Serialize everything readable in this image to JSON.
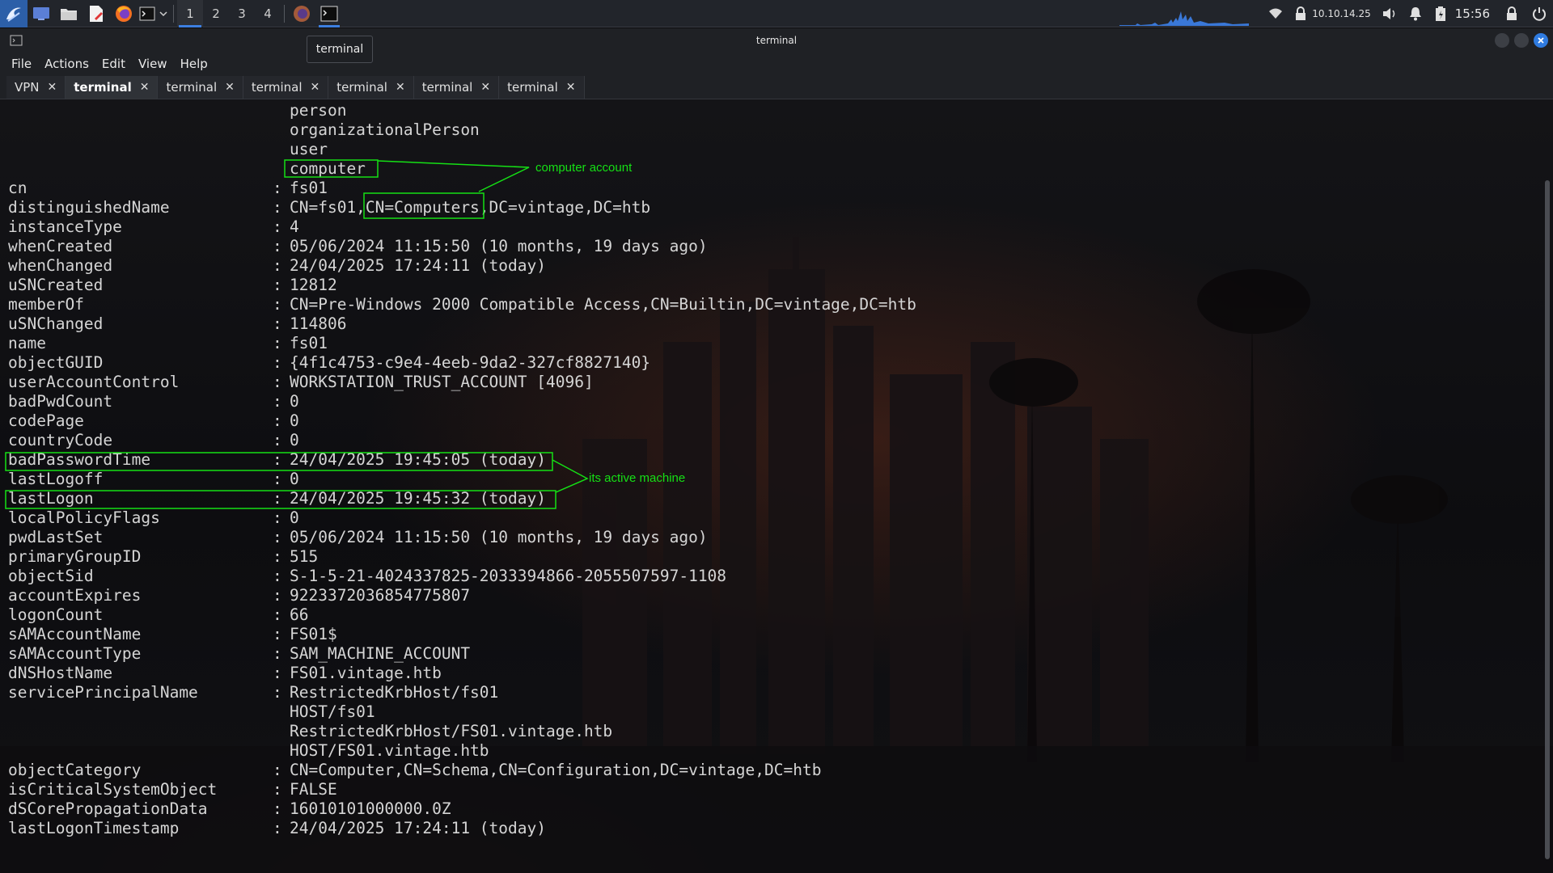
{
  "taskbar": {
    "workspaces": [
      "1",
      "2",
      "3",
      "4"
    ],
    "ip": "10.10.14.25",
    "time": "15:56",
    "icons": [
      "kali-menu-icon",
      "desktop-icon",
      "folder-icon",
      "text-editor-icon",
      "firefox-icon",
      "terminal-icon",
      "dropdown-icon",
      "firefox-task-icon",
      "terminal-task-icon",
      "wifi-icon",
      "vpn-lock-icon",
      "volume-icon",
      "bell-icon",
      "battery-icon",
      "lock-icon",
      "power-icon"
    ]
  },
  "tooltip": "terminal",
  "window": {
    "title": "terminal"
  },
  "menu": [
    "File",
    "Actions",
    "Edit",
    "View",
    "Help"
  ],
  "tabs": [
    {
      "label": "VPN",
      "active": false
    },
    {
      "label": "terminal",
      "active": true
    },
    {
      "label": "terminal",
      "active": false
    },
    {
      "label": "terminal",
      "active": false
    },
    {
      "label": "terminal",
      "active": false
    },
    {
      "label": "terminal",
      "active": false
    },
    {
      "label": "terminal",
      "active": false
    }
  ],
  "terminal": {
    "lines": [
      {
        "k": "",
        "v": "person"
      },
      {
        "k": "",
        "v": "organizationalPerson"
      },
      {
        "k": "",
        "v": "user"
      },
      {
        "k": "",
        "v": "computer"
      },
      {
        "k": "cn",
        "v": "fs01"
      },
      {
        "k": "distinguishedName",
        "v": "CN=fs01,CN=Computers,DC=vintage,DC=htb"
      },
      {
        "k": "instanceType",
        "v": "4"
      },
      {
        "k": "whenCreated",
        "v": "05/06/2024 11:15:50 (10 months, 19 days ago)"
      },
      {
        "k": "whenChanged",
        "v": "24/04/2025 17:24:11 (today)"
      },
      {
        "k": "uSNCreated",
        "v": "12812"
      },
      {
        "k": "memberOf",
        "v": "CN=Pre-Windows 2000 Compatible Access,CN=Builtin,DC=vintage,DC=htb"
      },
      {
        "k": "uSNChanged",
        "v": "114806"
      },
      {
        "k": "name",
        "v": "fs01"
      },
      {
        "k": "objectGUID",
        "v": "{4f1c4753-c9e4-4eeb-9da2-327cf8827140}"
      },
      {
        "k": "userAccountControl",
        "v": "WORKSTATION_TRUST_ACCOUNT [4096]"
      },
      {
        "k": "badPwdCount",
        "v": "0"
      },
      {
        "k": "codePage",
        "v": "0"
      },
      {
        "k": "countryCode",
        "v": "0"
      },
      {
        "k": "badPasswordTime",
        "v": "24/04/2025 19:45:05 (today)"
      },
      {
        "k": "lastLogoff",
        "v": "0"
      },
      {
        "k": "lastLogon",
        "v": "24/04/2025 19:45:32 (today)"
      },
      {
        "k": "localPolicyFlags",
        "v": "0"
      },
      {
        "k": "pwdLastSet",
        "v": "05/06/2024 11:15:50 (10 months, 19 days ago)"
      },
      {
        "k": "primaryGroupID",
        "v": "515"
      },
      {
        "k": "objectSid",
        "v": "S-1-5-21-4024337825-2033394866-2055507597-1108"
      },
      {
        "k": "accountExpires",
        "v": "9223372036854775807"
      },
      {
        "k": "logonCount",
        "v": "66"
      },
      {
        "k": "sAMAccountName",
        "v": "FS01$"
      },
      {
        "k": "sAMAccountType",
        "v": "SAM_MACHINE_ACCOUNT"
      },
      {
        "k": "dNSHostName",
        "v": "FS01.vintage.htb"
      },
      {
        "k": "servicePrincipalName",
        "v": "RestrictedKrbHost/fs01"
      },
      {
        "k": "",
        "v": "HOST/fs01"
      },
      {
        "k": "",
        "v": "RestrictedKrbHost/FS01.vintage.htb"
      },
      {
        "k": "",
        "v": "HOST/FS01.vintage.htb"
      },
      {
        "k": "objectCategory",
        "v": "CN=Computer,CN=Schema,CN=Configuration,DC=vintage,DC=htb"
      },
      {
        "k": "isCriticalSystemObject",
        "v": "FALSE"
      },
      {
        "k": "dSCorePropagationData",
        "v": "16010101000000.0Z"
      },
      {
        "k": "lastLogonTimestamp",
        "v": "24/04/2025 17:24:11 (today)"
      }
    ]
  },
  "annotations": {
    "computer_label": "computer account",
    "active_label": "its active machine",
    "color": "#15e015"
  }
}
